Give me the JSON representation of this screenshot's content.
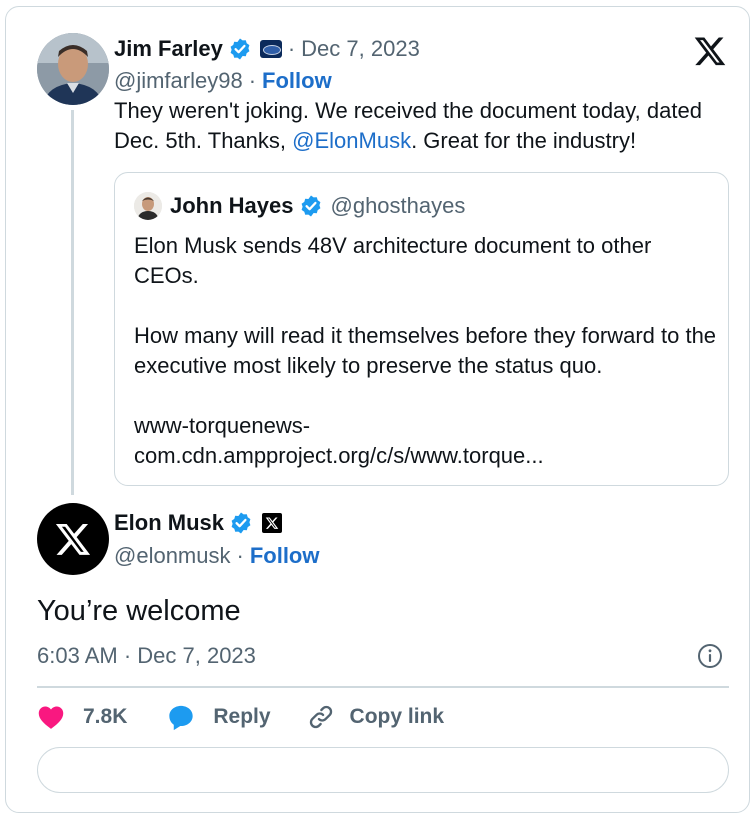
{
  "parent_tweet": {
    "author_name": "Jim Farley",
    "handle": "@jimfarley98",
    "date": "Dec 7, 2023",
    "separator": "·",
    "follow_label": "Follow",
    "text_before_mention": "They weren't joking. We received the document today, dated Dec. 5th. Thanks, ",
    "mention": "@ElonMusk",
    "text_after_mention": ". Great for the industry!",
    "affiliation_icon": "ford-badge-icon"
  },
  "quoted_tweet": {
    "author_name": "John Hayes",
    "handle": "@ghosthayes",
    "paragraph_1": "Elon Musk sends 48V architecture document to other CEOs.",
    "paragraph_2": "How many will read it themselves before they forward to the executive most likely to preserve the status quo.",
    "link_line_1": "www-torquenews-",
    "link_line_2": "com.cdn.ampproject.org/c/s/www.torque..."
  },
  "main_tweet": {
    "author_name": "Elon Musk",
    "handle": "@elonmusk",
    "separator": "·",
    "follow_label": "Follow",
    "text": "You’re welcome",
    "timestamp": "6:03 AM · Dec 7, 2023",
    "affiliation_icon": "x-badge-icon"
  },
  "actions": {
    "like_count": "7.8K",
    "reply_label": "Reply",
    "copy_link_label": "Copy link"
  },
  "read_replies_label": "",
  "colors": {
    "link_blue": "#1d6ec9",
    "verified_blue": "#1d9bf0",
    "like_pink": "#f91880",
    "muted_text": "#536471",
    "border": "#cfd9de"
  }
}
